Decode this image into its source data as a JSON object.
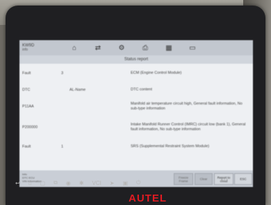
{
  "toolbar": {
    "vehicle_line1": "KW9D",
    "vehicle_line2": "info",
    "icons": [
      "home-icon",
      "vehicle-swap-icon",
      "settings-icon",
      "print-icon",
      "grid-icon",
      "save-icon"
    ]
  },
  "title": "Status report",
  "rows": [
    {
      "label": "Fault",
      "num": "3",
      "value": "",
      "desc": "ECM (Engine Control Module)"
    },
    {
      "label": "DTC",
      "num": "",
      "value": "AL-Name",
      "desc": "DTC content"
    },
    {
      "label": "P11AA",
      "num": "",
      "value": "",
      "desc": "Manifold air temperature circuit high, General fault information, No sub-type information"
    },
    {
      "label": "P200000",
      "num": "",
      "value": "",
      "desc": "Intake Manifold Runner Control (IMRC) circuit low (bank 1), General fault information, No sub-type information"
    },
    {
      "label": "Fault",
      "num": "1",
      "value": "",
      "desc": "SRS (Supplemental Restraint System Module)"
    }
  ],
  "bottom": {
    "info_lines": [
      "Info",
      "DTC ECU",
      "VIN Information"
    ],
    "buttons": {
      "freeze_frame": "Freeze Frame",
      "clear": "Clear",
      "report": "Report to cloud",
      "esc": "ESC"
    }
  },
  "nav": {
    "vci": "VCI",
    "status": "8:13"
  },
  "brand": "AUTEL"
}
